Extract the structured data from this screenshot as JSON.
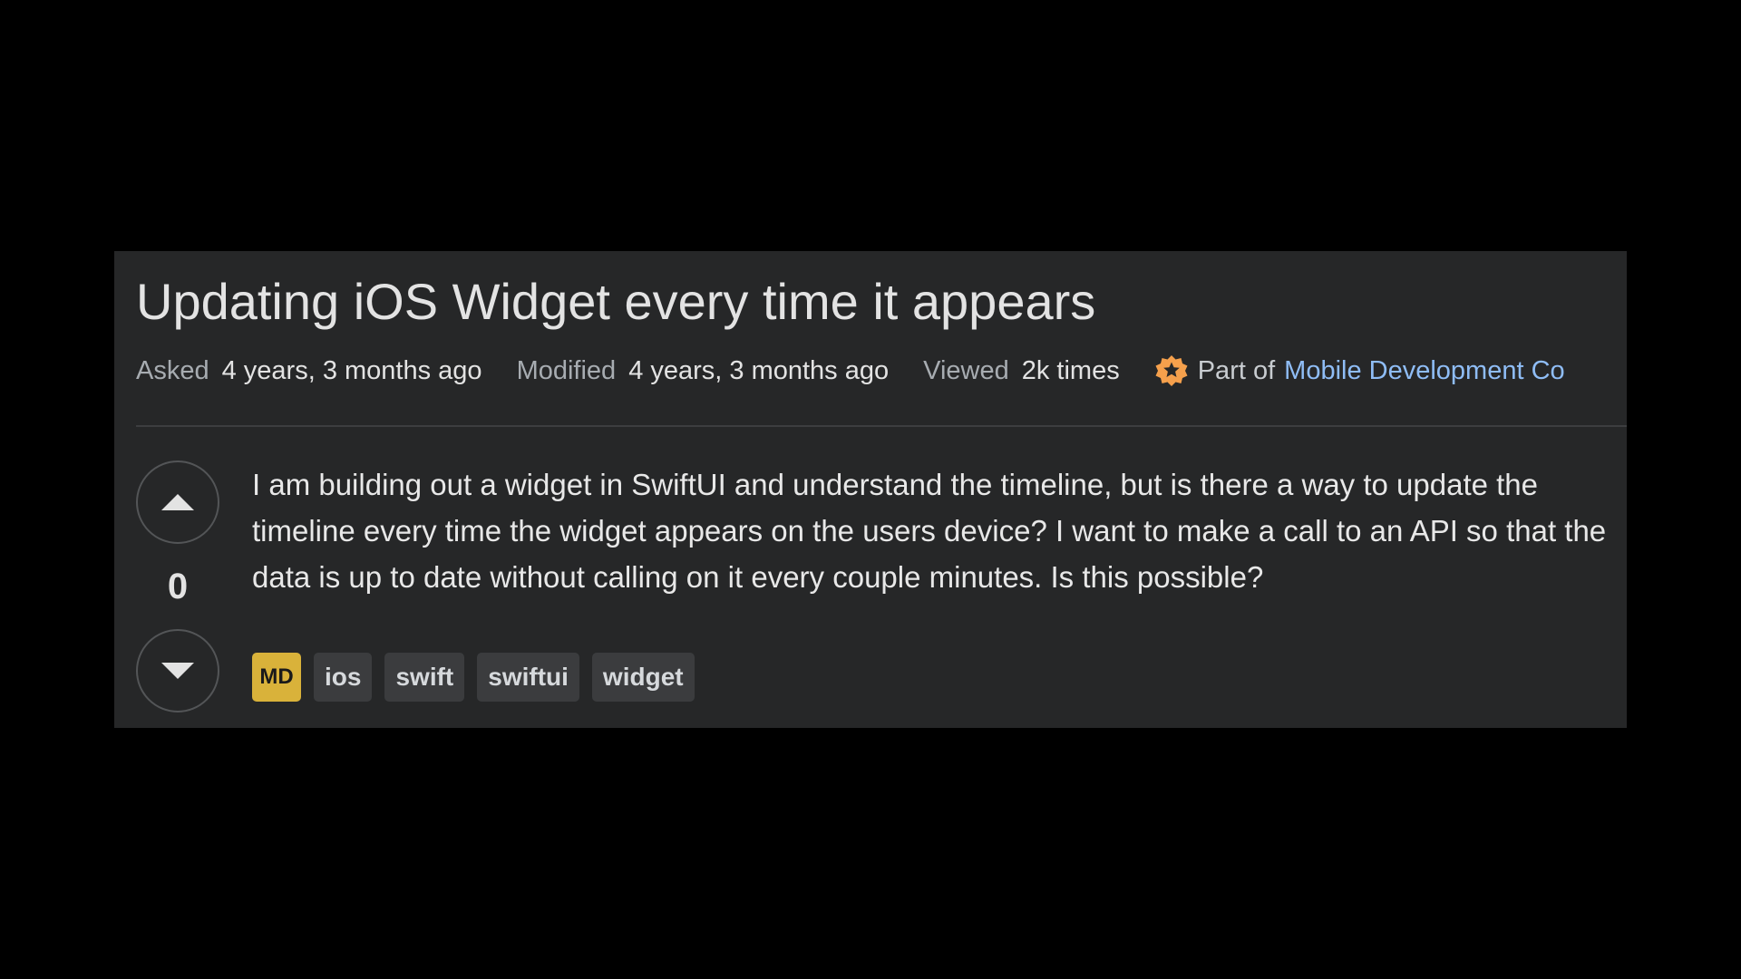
{
  "question": {
    "title": "Updating iOS Widget every time it appears",
    "meta": {
      "asked_label": "Asked",
      "asked_value": "4 years, 3 months ago",
      "modified_label": "Modified",
      "modified_value": "4 years, 3 months ago",
      "viewed_label": "Viewed",
      "viewed_value": "2k times"
    },
    "collective": {
      "icon": "collective-badge-icon",
      "prefix": "Part of",
      "link": "Mobile Development Co"
    },
    "votes": {
      "count": "0",
      "upvote_icon": "upvote-arrow-icon",
      "downvote_icon": "downvote-arrow-icon"
    },
    "body": "I am building out a widget in SwiftUI and understand the timeline, but is there a way to update the timeline every time the widget appears on the users device? I want to make a call to an API so that the data is up to date without calling on it every couple minutes. Is this possible?",
    "collective_tag": "MD",
    "tags": [
      "ios",
      "swift",
      "swiftui",
      "widget"
    ]
  },
  "colors": {
    "page_background": "#000000",
    "card_background": "#262728",
    "link": "#8fbdf6",
    "collective_badge": "#d9b23a",
    "collective_icon": "#f5a04c"
  }
}
